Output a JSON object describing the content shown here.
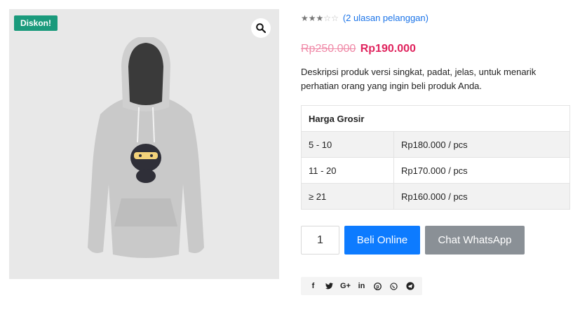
{
  "product": {
    "sale_badge": "Diskon!",
    "rating": {
      "stars_filled": 3,
      "stars_total": 5,
      "reviews_text": "(2 ulasan pelanggan)"
    },
    "price": {
      "regular": "Rp250.000",
      "sale": "Rp190.000"
    },
    "description": "Deskripsi produk versi singkat, padat, jelas, untuk menarik perhatian orang yang ingin beli produk Anda.",
    "wholesale": {
      "header": "Harga Grosir",
      "rows": [
        {
          "qty": "5 - 10",
          "price": "Rp180.000 / pcs"
        },
        {
          "qty": "11 - 20",
          "price": "Rp170.000 / pcs"
        },
        {
          "qty": "≥ 21",
          "price": "Rp160.000 / pcs"
        }
      ]
    },
    "quantity": "1",
    "buy_label": "Beli Online",
    "whatsapp_label": "Chat WhatsApp"
  },
  "share": {
    "icons": [
      {
        "name": "facebook-icon",
        "glyph": "f"
      },
      {
        "name": "twitter-icon",
        "glyph": "🐦"
      },
      {
        "name": "google-plus-icon",
        "glyph": "G+"
      },
      {
        "name": "linkedin-icon",
        "glyph": "in"
      },
      {
        "name": "pinterest-icon",
        "glyph": "℗"
      },
      {
        "name": "whatsapp-icon",
        "glyph": "✆"
      },
      {
        "name": "telegram-icon",
        "glyph": "➤"
      }
    ]
  },
  "colors": {
    "badge": "#1a9a7c",
    "sale_price": "#e0245e",
    "buy_button": "#0d7bff",
    "whatsapp_button": "#8a9096",
    "link": "#1a73e8"
  }
}
